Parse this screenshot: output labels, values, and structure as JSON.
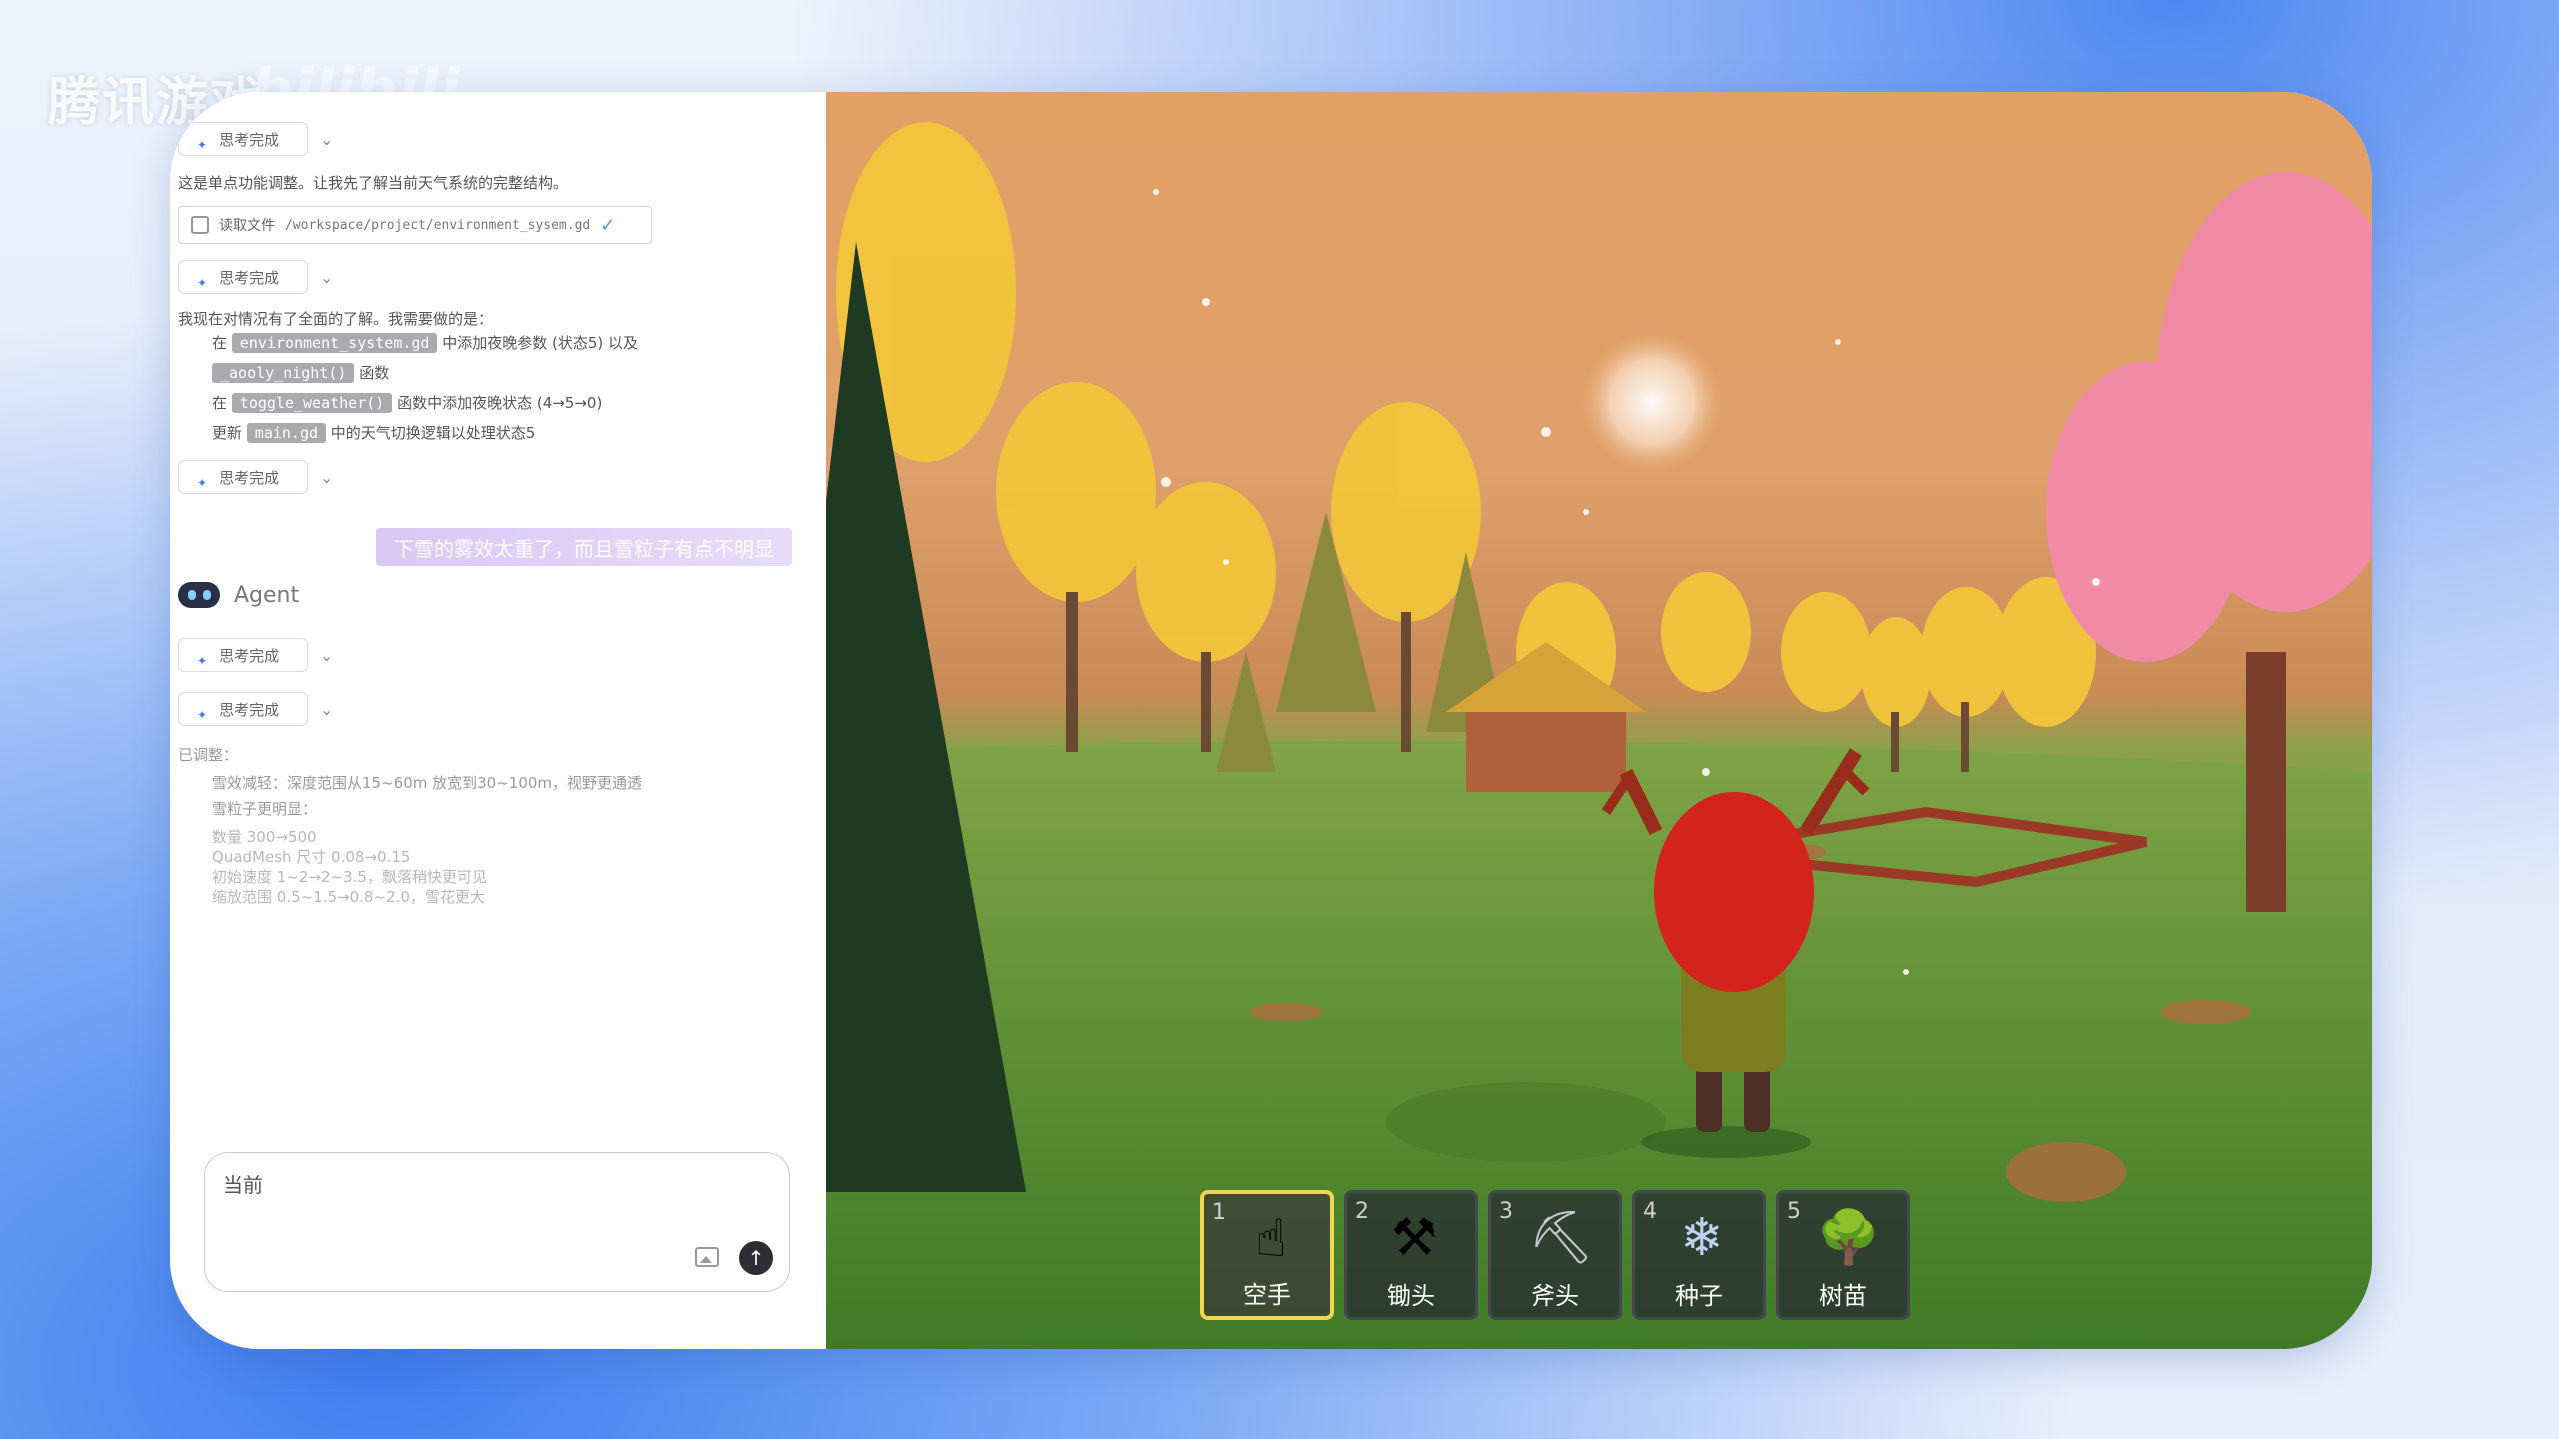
{
  "watermark": {
    "brand": "腾讯游戏",
    "partner": "bilibili"
  },
  "chat": {
    "think_label": "思考完成",
    "intro_text": "这是单点功能调整。让我先了解当前天气系统的完整结构。",
    "read_file": {
      "label": "读取文件",
      "path": "/workspace/project/environment_sysem.gd"
    },
    "plan_intro": "我现在对情况有了全面的了解。我需要做的是：",
    "plan": [
      {
        "prefix": "在",
        "code": "environment_system.gd",
        "suffix": "中添加夜晚参数 (状态5) 以及"
      },
      {
        "prefix": "",
        "code": "_aooly_night()",
        "suffix": "函数"
      },
      {
        "prefix": "在",
        "code": "toggle_weather()",
        "suffix": "函数中添加夜晚状态  (4→5→0)"
      },
      {
        "prefix": "更新",
        "code": "main.gd",
        "suffix": "中的天气切换逻辑以处理状态5"
      }
    ],
    "user_message": "下雪的雾效太重了，而且雪粒子有点不明显",
    "agent_name": "Agent",
    "adjusted_label": "已调整：",
    "adjust_lines": [
      "雪效减轻：深度范围从15~60m 放宽到30~100m，视野更通透",
      "雪粒子更明显："
    ],
    "adjust_sublines": [
      "数量 300→500",
      "QuadMesh 尺寸 0.08→0.15",
      "初始速度 1~2→2~3.5，飘落稍快更可见",
      "缩放范围 0.5~1.5→0.8~2.0，雪花更大"
    ],
    "input": {
      "value": "当前"
    }
  },
  "hotbar": [
    {
      "num": "1",
      "label": "空手",
      "icon": "hand-icon",
      "active": true
    },
    {
      "num": "2",
      "label": "锄头",
      "icon": "hoe-icon",
      "active": false
    },
    {
      "num": "3",
      "label": "斧头",
      "icon": "axe-icon",
      "active": false
    },
    {
      "num": "4",
      "label": "种子",
      "icon": "seed-icon",
      "active": false
    },
    {
      "num": "5",
      "label": "树苗",
      "icon": "sapling-icon",
      "active": false
    }
  ],
  "colors": {
    "accent_slot": "#f2d550",
    "user_bubble": "#e3d9f7"
  }
}
